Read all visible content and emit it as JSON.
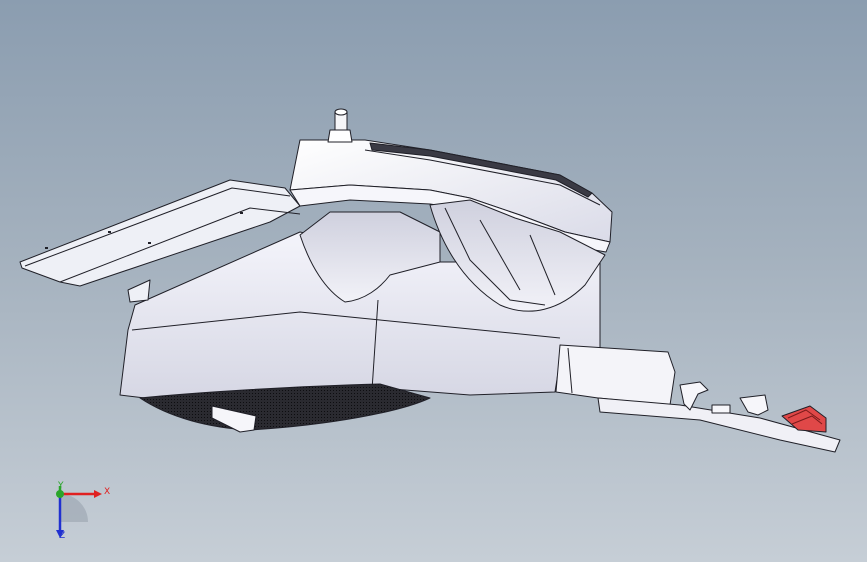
{
  "triad": {
    "x_label": "X",
    "y_label": "Y",
    "z_label": "Z",
    "x_color": "#e02020",
    "y_color": "#2aa52a",
    "z_color": "#2030d0"
  },
  "model": {
    "body_color": "#f2f2fa",
    "shade_color": "#c9cbd8",
    "edge_color": "#202028",
    "grille_color": "#1a1a1f",
    "highlight_color": "#e04848"
  }
}
